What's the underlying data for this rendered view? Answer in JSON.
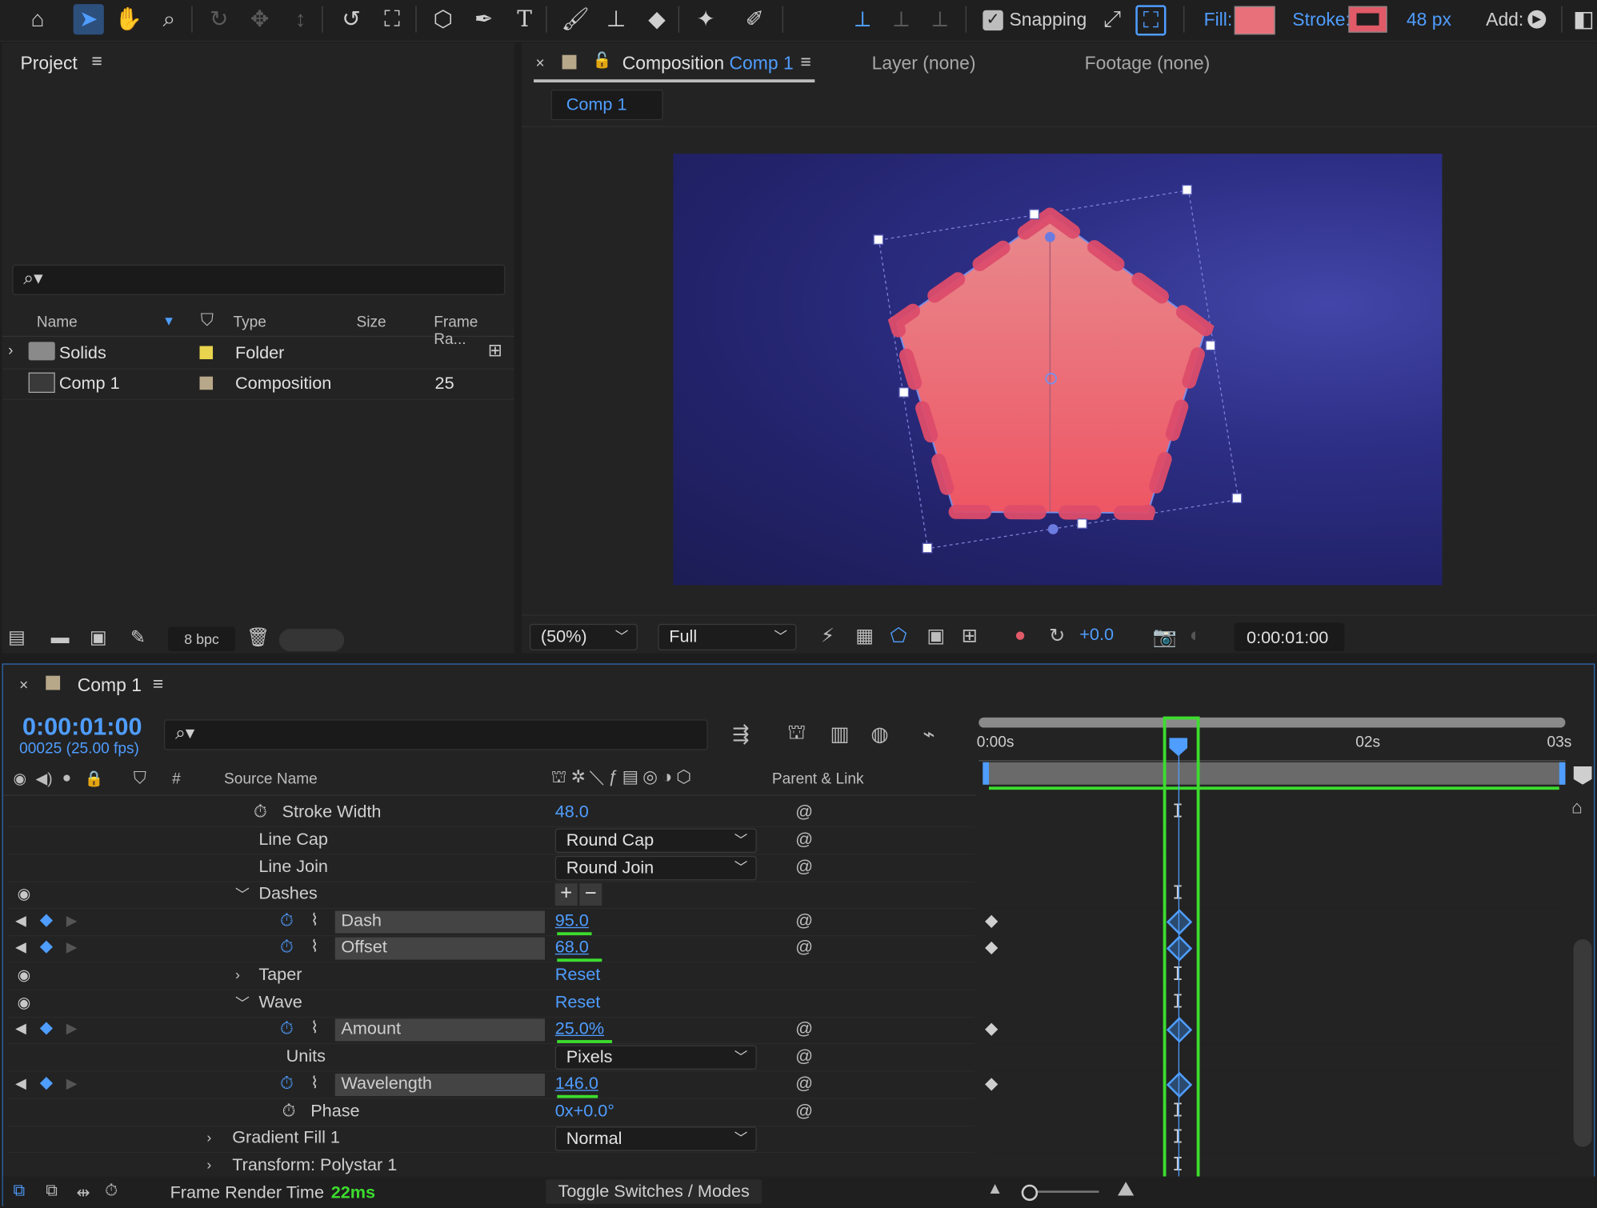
{
  "toolbar": {
    "snapping_label": "Snapping",
    "fill_label": "Fill:",
    "stroke_label": "Stroke:",
    "stroke_width": "48 px",
    "add_label": "Add:",
    "fill_color": "#e8707a",
    "stroke_color": "#e05a68"
  },
  "project": {
    "title": "Project",
    "columns": [
      "Name",
      "Type",
      "Size",
      "Frame Ra..."
    ],
    "items": [
      {
        "name": "Solids",
        "type": "Folder",
        "size": "",
        "fps": "",
        "label_color": "#e8d44d"
      },
      {
        "name": "Comp 1",
        "type": "Composition",
        "size": "",
        "fps": "25",
        "label_color": "#b8a88a"
      }
    ],
    "bpc": "8 bpc"
  },
  "viewer": {
    "tab_prefix": "Composition",
    "tab_comp": "Comp 1",
    "layer_tab": "Layer (none)",
    "footage_tab": "Footage (none)",
    "breadcrumb": "Comp 1",
    "zoom": "(50%)",
    "resolution": "Full",
    "exposure": "+0.0",
    "timecode": "0:00:01:00"
  },
  "timeline": {
    "comp_tab": "Comp 1",
    "current_time": "0:00:01:00",
    "frame_info": "00025 (25.00 fps)",
    "col_num": "#",
    "col_source": "Source Name",
    "col_parent": "Parent & Link",
    "ruler": [
      "0:00s",
      "02s",
      "03s"
    ],
    "properties": [
      {
        "name": "Stroke Width",
        "value": "48.0"
      },
      {
        "name": "Line Cap",
        "value": "Round Cap"
      },
      {
        "name": "Line Join",
        "value": "Round Join"
      },
      {
        "name": "Dashes",
        "value": ""
      },
      {
        "name": "Dash",
        "value": "95.0"
      },
      {
        "name": "Offset",
        "value": "68.0"
      },
      {
        "name": "Taper",
        "value": "Reset"
      },
      {
        "name": "Wave",
        "value": "Reset"
      },
      {
        "name": "Amount",
        "value": "25.0%"
      },
      {
        "name": "Units",
        "value": "Pixels"
      },
      {
        "name": "Wavelength",
        "value": "146.0"
      },
      {
        "name": "Phase",
        "value": "0x+0.0°"
      },
      {
        "name": "Gradient Fill 1",
        "value": "Normal"
      },
      {
        "name": "Transform: Polystar 1",
        "value": ""
      }
    ],
    "render_label": "Frame Render Time",
    "render_value": "22ms",
    "toggle_label": "Toggle Switches / Modes"
  }
}
